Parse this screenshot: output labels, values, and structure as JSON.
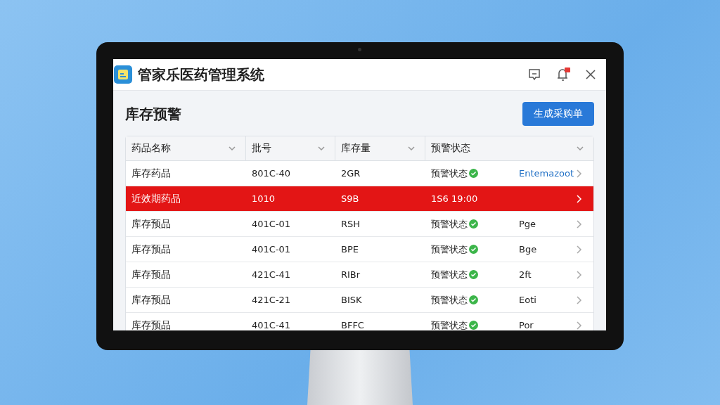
{
  "window": {
    "title": "管家乐医药管理系统",
    "notification_badge": true
  },
  "page": {
    "title": "库存预警",
    "action_button": "生成采购单"
  },
  "table": {
    "columns": [
      "药品名称",
      "批号",
      "库存量",
      "预警状态"
    ],
    "rows": [
      {
        "name": "库存药品",
        "batch": "801C-40",
        "stock": "2GR",
        "status": "预警状态",
        "ok": true,
        "alert": false,
        "extra": "Entemazoot",
        "extra_link": true
      },
      {
        "name": "近效期药品",
        "batch": "1010",
        "stock": "S9B",
        "status": "1S6 19:00",
        "ok": false,
        "alert": true
      },
      {
        "name": "库存预品",
        "batch": "401C-01",
        "stock": "RSH",
        "status": "预警状态",
        "ok": true,
        "alert": false,
        "extra": "Pge",
        "extra_link": false
      },
      {
        "name": "库存预品",
        "batch": "401C-01",
        "stock": "BPE",
        "status": "预警状态",
        "ok": true,
        "alert": false,
        "extra": "Bge",
        "extra_link": false
      },
      {
        "name": "库存预品",
        "batch": "421C-41",
        "stock": "RIBr",
        "status": "预警状态",
        "ok": true,
        "alert": false,
        "extra": "2ft",
        "extra_link": false
      },
      {
        "name": "库存预品",
        "batch": "421C-21",
        "stock": "BISK",
        "status": "预警状态",
        "ok": true,
        "alert": false,
        "extra": "Eoti",
        "extra_link": false
      },
      {
        "name": "库存预品",
        "batch": "401C-41",
        "stock": "BFFC",
        "status": "预警状态",
        "ok": true,
        "alert": false,
        "extra": "Por",
        "extra_link": false
      }
    ]
  }
}
